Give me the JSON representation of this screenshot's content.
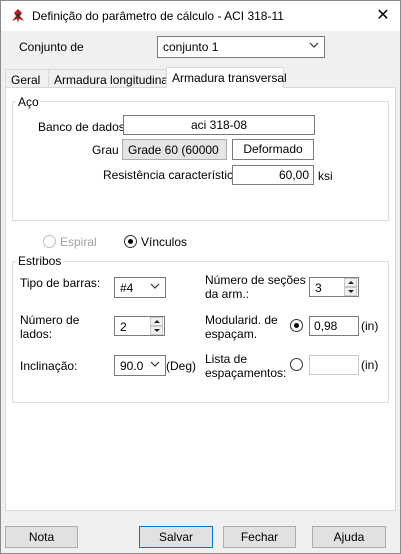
{
  "window": {
    "title": "Definição do parâmetro de cálculo - ACI 318-11"
  },
  "header": {
    "conjunto_label": "Conjunto de",
    "conjunto_value": "conjunto 1"
  },
  "tabs": [
    {
      "label": "Geral",
      "active": false
    },
    {
      "label": "Armadura longitudinal",
      "active": false
    },
    {
      "label": "Armadura transversal",
      "active": true
    }
  ],
  "aco": {
    "group_label": "Aço",
    "banco_label": "Banco de dados",
    "banco_value": "aci 318-08",
    "grau_label": "Grau",
    "grau_value": "Grade 60 (60000",
    "deformado_label": "Deformado",
    "resistencia_label": "Resistência característica",
    "resistencia_value": "60,00",
    "resistencia_unit": "ksi"
  },
  "type_options": {
    "espiral_label": "Espiral",
    "espiral_selected": false,
    "espiral_enabled": false,
    "vinculos_label": "Vínculos",
    "vinculos_selected": true
  },
  "estribos": {
    "group_label": "Estribos",
    "tipo_label": "Tipo de barras:",
    "tipo_value": "#4",
    "num_lados_label_1": "Número de",
    "num_lados_label_2": "lados:",
    "num_lados_value": "2",
    "inclinacao_label": "Inclinação:",
    "inclinacao_value": "90.0",
    "inclinacao_unit": "(Deg)",
    "num_secoes_label_1": "Número de seções",
    "num_secoes_label_2": "da arm.:",
    "num_secoes_value": "3",
    "modularid_label_1": "Modularid. de",
    "modularid_label_2": "espaçam.",
    "modularid_selected": true,
    "modularid_value": "0,98",
    "modularid_unit": "(in)",
    "lista_label_1": "Lista de",
    "lista_label_2": "espaçamentos:",
    "lista_selected": false,
    "lista_value": "",
    "lista_unit": "(in)"
  },
  "footer": {
    "nota_label": "Nota",
    "salvar_label": "Salvar",
    "fechar_label": "Fechar",
    "ajuda_label": "Ajuda"
  },
  "icons": {
    "app": "robot-app-icon",
    "close": "close-icon",
    "dropdown": "chevron-down-icon",
    "spin_up": "spin-up-icon",
    "spin_down": "spin-down-icon"
  },
  "colors": {
    "default_button_border": "#0078d7",
    "window_bg": "#f0f0f0",
    "panel_bg": "#ffffff"
  }
}
